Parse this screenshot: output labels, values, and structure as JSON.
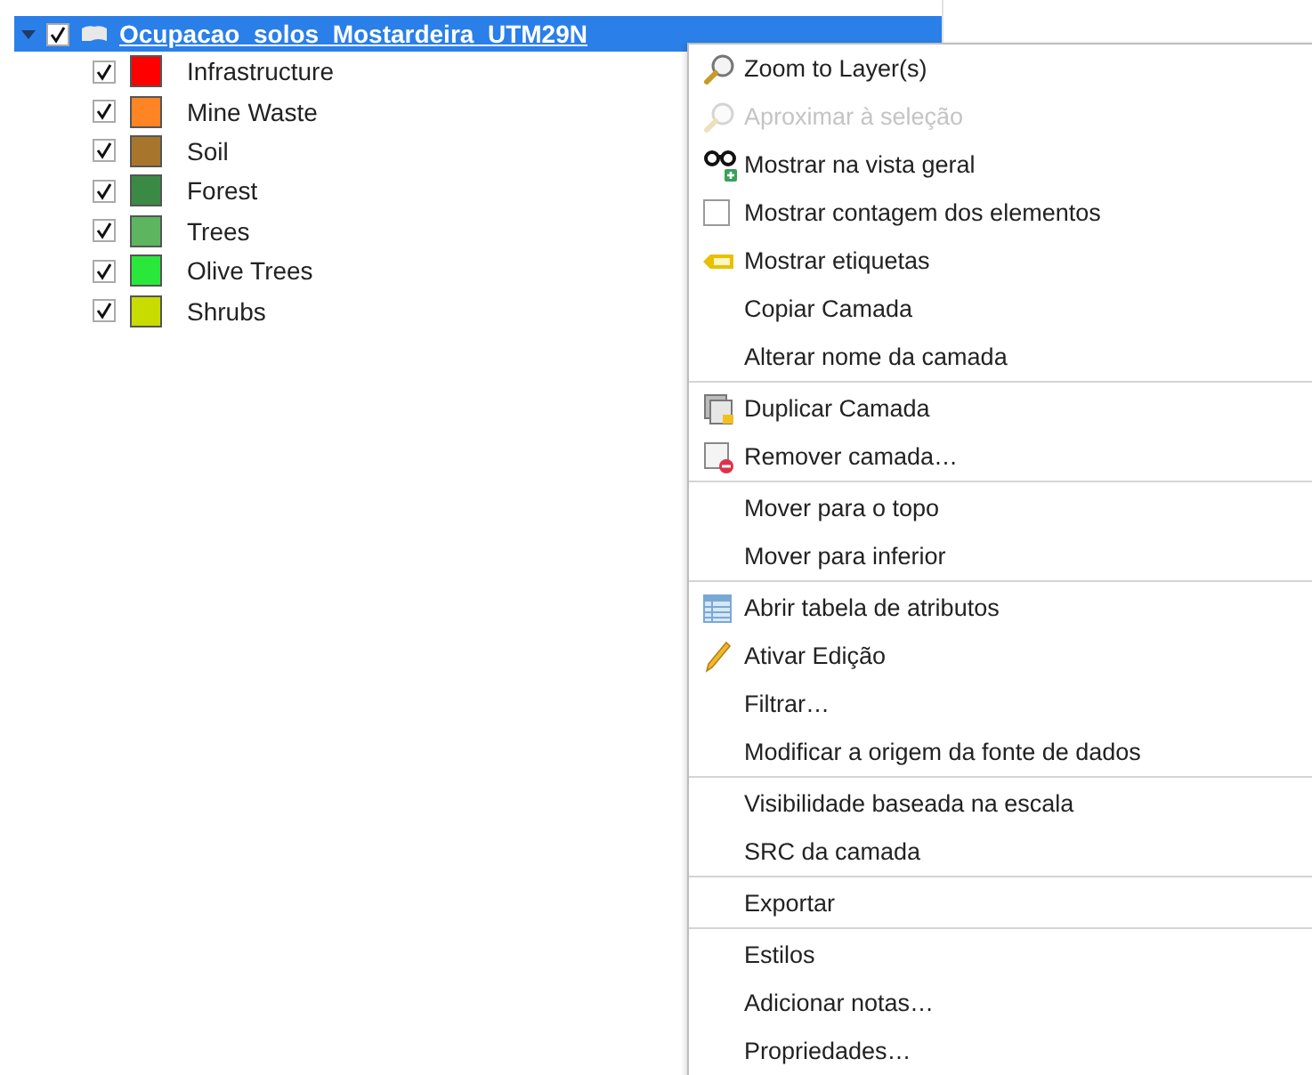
{
  "layer": {
    "name": "Ocupacao_solos_Mostardeira_UTM29N",
    "expanded": true,
    "checked": true,
    "selected": true,
    "classes": [
      {
        "label": "Infrastructure",
        "checked": true,
        "color": "#ff0000"
      },
      {
        "label": "Mine Waste",
        "checked": true,
        "color": "#ff8424"
      },
      {
        "label": "Soil",
        "checked": true,
        "color": "#a7762c"
      },
      {
        "label": "Forest",
        "checked": true,
        "color": "#3a8a45"
      },
      {
        "label": "Trees",
        "checked": true,
        "color": "#5db65f"
      },
      {
        "label": "Olive Trees",
        "checked": true,
        "color": "#2ae83a"
      },
      {
        "label": "Shrubs",
        "checked": true,
        "color": "#c8dc00"
      }
    ]
  },
  "context_menu": {
    "sections": [
      {
        "items": [
          {
            "label": "Zoom to Layer(s)",
            "kind": "zoom",
            "disabled": false
          },
          {
            "label": "Aproximar à seleção",
            "kind": "zoom",
            "disabled": true
          },
          {
            "label": "Mostrar na vista geral",
            "kind": "glasses",
            "disabled": false
          },
          {
            "label": "Mostrar contagem dos elementos",
            "kind": "checkbox",
            "checked": false,
            "disabled": false
          },
          {
            "label": "Mostrar etiquetas",
            "kind": "tag",
            "disabled": false
          },
          {
            "label": "Copiar Camada",
            "kind": "plain",
            "disabled": false
          },
          {
            "label": "Alterar nome da camada",
            "kind": "plain",
            "disabled": false
          }
        ]
      },
      {
        "items": [
          {
            "label": "Duplicar Camada",
            "kind": "duplicate",
            "disabled": false
          },
          {
            "label": "Remover camada…",
            "kind": "remove",
            "disabled": false
          }
        ]
      },
      {
        "items": [
          {
            "label": "Mover para o topo",
            "kind": "plain",
            "disabled": false
          },
          {
            "label": "Mover para  inferior",
            "kind": "plain",
            "disabled": false
          }
        ]
      },
      {
        "items": [
          {
            "label": "Abrir tabela de atributos",
            "kind": "table",
            "disabled": false
          },
          {
            "label": "Ativar Edição",
            "kind": "pencil",
            "disabled": false
          },
          {
            "label": "Filtrar…",
            "kind": "plain",
            "disabled": false
          },
          {
            "label": "Modificar a origem da fonte de dados",
            "kind": "plain",
            "disabled": false
          }
        ]
      },
      {
        "items": [
          {
            "label": "Visibilidade baseada na escala",
            "kind": "plain",
            "disabled": false
          },
          {
            "label": "SRC da camada",
            "kind": "plain",
            "disabled": false
          }
        ]
      },
      {
        "items": [
          {
            "label": "Exportar",
            "kind": "plain",
            "disabled": false
          }
        ]
      },
      {
        "items": [
          {
            "label": "Estilos",
            "kind": "plain",
            "disabled": false
          },
          {
            "label": "Adicionar notas…",
            "kind": "plain",
            "disabled": false
          },
          {
            "label": "Propriedades…",
            "kind": "plain",
            "disabled": false
          }
        ]
      }
    ]
  }
}
